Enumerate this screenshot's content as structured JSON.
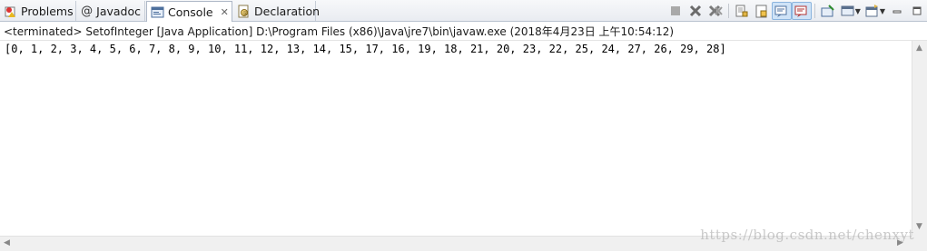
{
  "tabs": [
    {
      "label": "Problems",
      "icon": "problems-icon"
    },
    {
      "label": "Javadoc",
      "icon": "at-icon",
      "glyph": "@"
    },
    {
      "label": "Console",
      "icon": "console-icon",
      "active": true,
      "close": "✕"
    },
    {
      "label": "Declaration",
      "icon": "declaration-icon"
    }
  ],
  "toolbar": {
    "icons": [
      "terminate-icon",
      "remove-launch-icon",
      "remove-all-terminated-icon",
      "scroll-lock-icon",
      "word-wrap-icon",
      "show-console-on-output-icon",
      "show-console-on-error-icon",
      "pin-console-icon",
      "display-selected-console-icon",
      "open-console-icon",
      "minimize-icon",
      "maximize-icon"
    ]
  },
  "status": {
    "text": "<terminated> SetofInteger [Java Application] D:\\Program Files (x86)\\Java\\jre7\\bin\\javaw.exe (2018年4月23日 上午10:54:12)"
  },
  "console": {
    "output": "[0, 1, 2, 3, 4, 5, 6, 7, 8, 9, 10, 11, 12, 13, 14, 15, 17, 16, 19, 18, 21, 20, 23, 22, 25, 24, 27, 26, 29, 28]"
  },
  "watermark": "https://blog.csdn.net/chenxyt",
  "colors": {
    "accent": "#2e6bb5",
    "pressed_bg": "#cfe3f7"
  }
}
